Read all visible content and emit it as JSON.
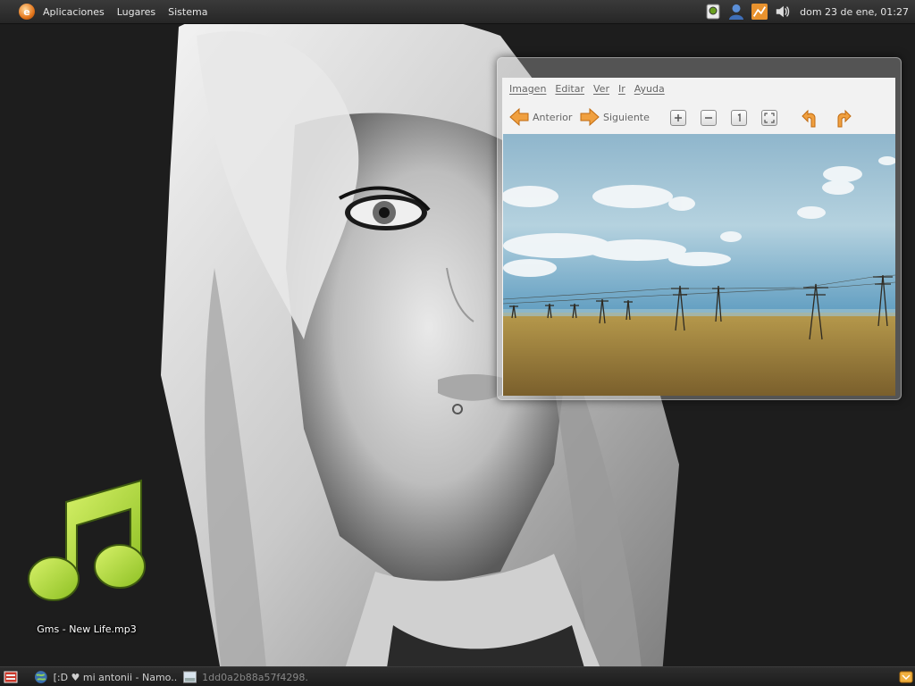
{
  "top_panel": {
    "menus": [
      {
        "label": "Aplicaciones"
      },
      {
        "label": "Lugares"
      },
      {
        "label": "Sistema"
      }
    ],
    "logo_icon": "distro-logo-icon",
    "tray_icons": [
      "monitor-icon",
      "user-icon",
      "network-icon",
      "volume-icon"
    ],
    "clock": "dom 23 de ene, 01:27"
  },
  "viewer": {
    "menu": [
      {
        "label": "Imagen"
      },
      {
        "label": "Editar"
      },
      {
        "label": "Ver"
      },
      {
        "label": "Ir"
      },
      {
        "label": "Ayuda"
      }
    ],
    "toolbar": {
      "prev_label": "Anterior",
      "next_label": "Siguiente",
      "zoom_in_icon": "zoom-in-icon",
      "zoom_out_icon": "zoom-out-icon",
      "zoom_normal_icon": "zoom-normal-icon",
      "zoom_fit_icon": "zoom-fit-icon",
      "rotate_left_icon": "rotate-left-icon",
      "rotate_right_icon": "rotate-right-icon"
    },
    "accent_color": "#e8922e"
  },
  "desktop": {
    "icons": [
      {
        "label": "Gms - New Life.mp3",
        "icon": "music-note-icon"
      }
    ]
  },
  "bottom_panel": {
    "tasks": [
      {
        "label": "[:D ♥ mi antonii - Namo...",
        "icon": "globe-icon"
      },
      {
        "label": "1dd0a2b88a57f4298...",
        "icon": "image-icon"
      }
    ]
  }
}
